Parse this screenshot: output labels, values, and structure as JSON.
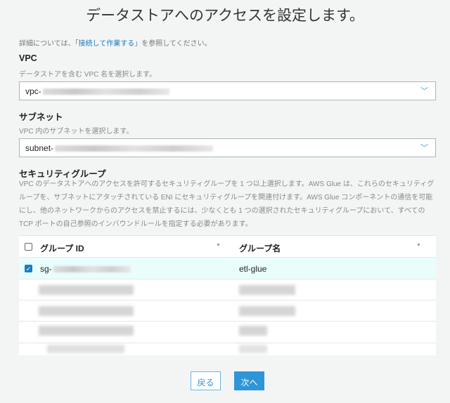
{
  "title": "データストアへのアクセスを設定します。",
  "info": {
    "prefix": "詳細については、「",
    "link": "接続して作業する",
    "suffix": "」を参照してください。"
  },
  "vpc": {
    "label": "VPC",
    "help": "データストアを含む VPC 名を選択します。",
    "value_prefix": "vpc-",
    "icon": "chevron-down-icon"
  },
  "subnet": {
    "label": "サブネット",
    "help": "VPC 内のサブネットを選択します。",
    "value_prefix": "subnet-",
    "icon": "chevron-down-icon"
  },
  "security": {
    "label": "セキュリティグループ",
    "help": "VPC のデータストアへのアクセスを許可するセキュリティグループを 1 つ以上選択します。AWS Glue は、これらのセキュリティグループを、サブネットにアタッチされている ENI にセキュリティグループを関連付けます。AWS Glue コンポーネントの通信を可能にし、他のネットワークからのアクセスを禁止するには、少なくとも 1 つの選択されたセキュリティグループにおいて、すべての TCP ポートの自己参照のインバウンドルールを指定する必要があります。"
  },
  "table": {
    "columns": [
      "グループ ID",
      "グループ名"
    ],
    "rows": [
      {
        "id_prefix": "sg-",
        "name": "etl-glue",
        "checked": true
      }
    ]
  },
  "buttons": {
    "back": "戻る",
    "next": "次へ"
  },
  "colors": {
    "accent": "#2e96d8",
    "link": "#1a7cc1",
    "selected_row": "#e9fdfd"
  }
}
